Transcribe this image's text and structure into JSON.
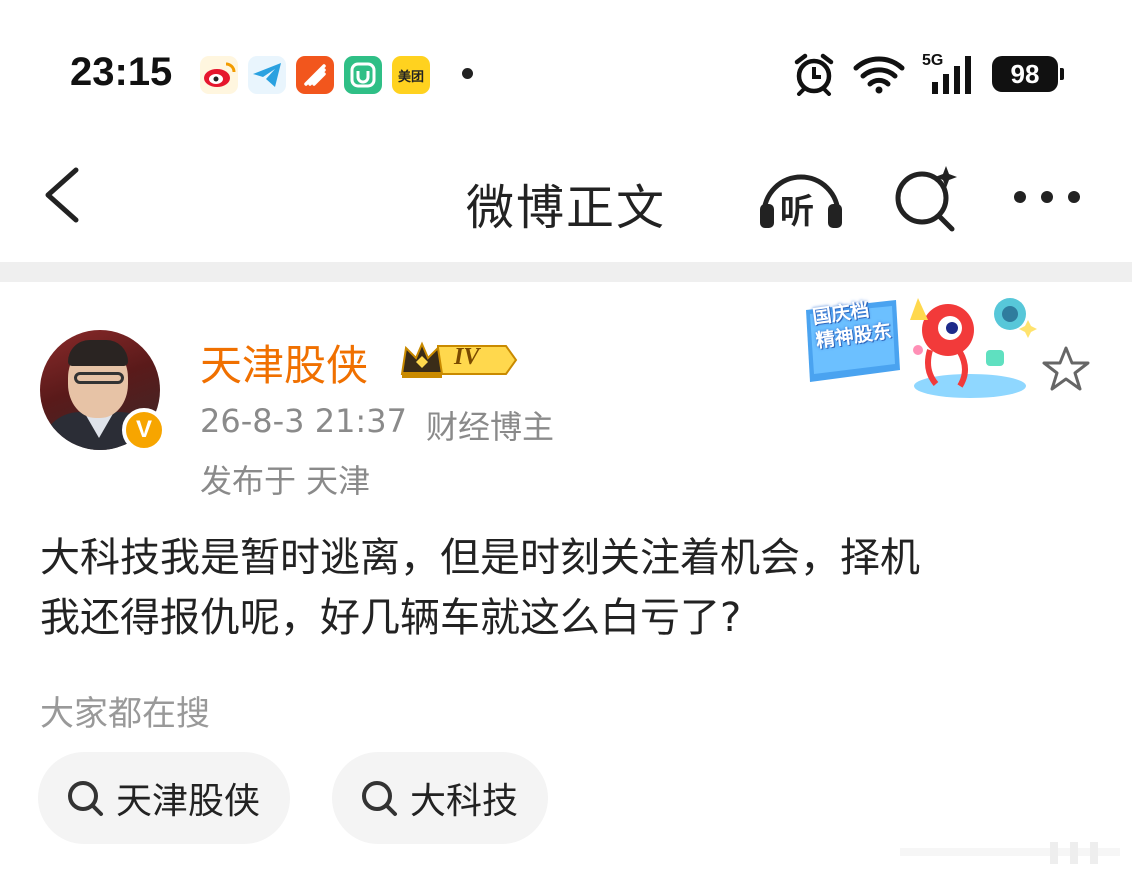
{
  "status_bar": {
    "time": "23:15",
    "notification_apps": [
      {
        "name": "weibo-app-icon",
        "color": "#f5c84a",
        "glyph": "◎"
      },
      {
        "name": "telegram-app-icon",
        "color": "#35a7e8",
        "glyph": "➤"
      },
      {
        "name": "app-orange-icon",
        "color": "#f2561d",
        "glyph": "✈"
      },
      {
        "name": "xiaomi-app-icon",
        "color": "#32c08a",
        "glyph": "U"
      },
      {
        "name": "meituan-app-icon",
        "color": "#ffcf1a",
        "glyph": "美团"
      }
    ],
    "network": "5G",
    "battery": "98"
  },
  "nav": {
    "title": "微博正文",
    "listen_label": "听"
  },
  "post": {
    "username": "天津股侠",
    "level": "IV",
    "verified_badge": "V",
    "time": "26-8-3 21:37",
    "source": "财经博主",
    "location": "发布于 天津",
    "banner_text": "国庆档 精神股东",
    "body_lines": [
      "大科技我是暂时逃离，但是时刻关注着机会，择机",
      "我还得报仇呢，好几辆车就这么白亏了?"
    ]
  },
  "trending": {
    "label": "大家都在搜",
    "tags": [
      "天津股侠",
      "大科技"
    ]
  },
  "colors": {
    "accent": "#f07000",
    "muted": "#8a8a8a",
    "tag_bg": "#f4f4f4",
    "divider": "#efefef"
  }
}
